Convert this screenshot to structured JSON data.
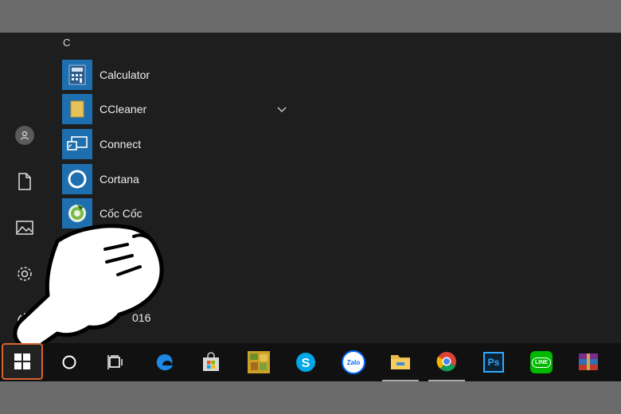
{
  "start_menu": {
    "section_letter": "C",
    "apps": [
      {
        "label": "Calculator",
        "icon": "calculator-icon"
      },
      {
        "label": "CCleaner",
        "icon": "ccleaner-folder-icon",
        "expandable": true
      },
      {
        "label": "Connect",
        "icon": "connect-icon"
      },
      {
        "label": "Cortana",
        "icon": "cortana-icon"
      },
      {
        "label": "Cốc Cốc",
        "icon": "coccoc-icon"
      }
    ],
    "partial_app_label": "016"
  },
  "left_rail": [
    "user-avatar-icon",
    "documents-icon",
    "pictures-icon",
    "settings-icon",
    "power-icon"
  ],
  "taskbar": {
    "items": [
      "windows-start-icon",
      "cortana-search-icon",
      "task-view-icon",
      "edge-icon",
      "store-icon",
      "game-icon",
      "skype-icon",
      "zalo-icon",
      "file-explorer-icon",
      "chrome-icon",
      "photoshop-icon",
      "line-icon",
      "winrar-icon"
    ],
    "zalo_text": "Zalo",
    "ps_text": "Ps",
    "line_text": "LINE"
  },
  "colors": {
    "accent": "#1e6fb0",
    "highlight": "#d9632e"
  }
}
